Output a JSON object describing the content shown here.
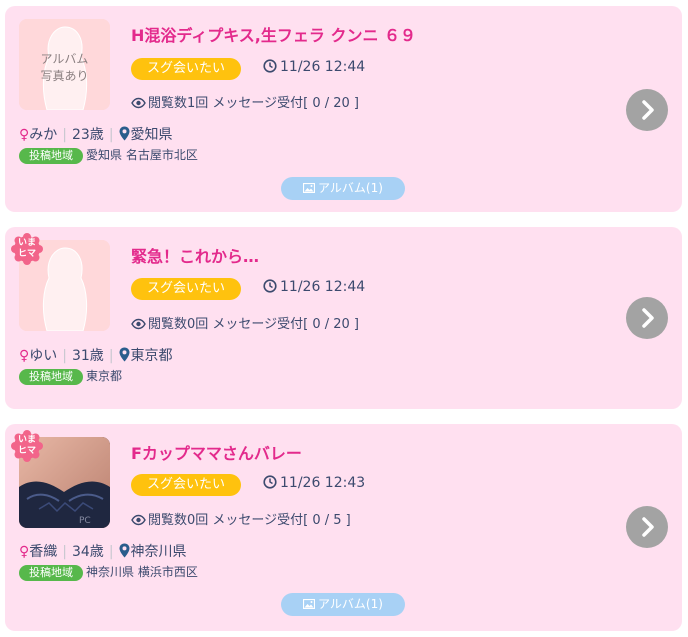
{
  "posts": [
    {
      "thumb_text": "アルバム\n写真あり",
      "badge": "",
      "title": "H混浴ディプキス,生フェラ クンニ ６９",
      "status_pill": "スグ会いたい",
      "time": "11/26 12:44",
      "views": "閲覧数1回 メッセージ受付[ 0 / 20 ]",
      "name": "みか",
      "age": "23歳",
      "prefecture": "愛知県",
      "region_label": "投稿地域",
      "region": "愛知県 名古屋市北区",
      "album": "アルバム(1)"
    },
    {
      "thumb_text": "",
      "badge": "いま\nヒマ",
      "title": "緊急！これから…",
      "status_pill": "スグ会いたい",
      "time": "11/26 12:44",
      "views": "閲覧数0回 メッセージ受付[ 0 / 20 ]",
      "name": "ゆい",
      "age": "31歳",
      "prefecture": "東京都",
      "region_label": "投稿地域",
      "region": "東京都",
      "album": ""
    },
    {
      "thumb_text": "",
      "badge": "いま\nヒマ",
      "title": "Fカップママさんバレー",
      "status_pill": "スグ会いたい",
      "time": "11/26 12:43",
      "views": "閲覧数0回 メッセージ受付[ 0 / 5 ]",
      "name": "香織",
      "age": "34歳",
      "prefecture": "神奈川県",
      "region_label": "投稿地域",
      "region": "神奈川県 横浜市西区",
      "album": "アルバム(1)"
    }
  ],
  "icons": {
    "female": "♀",
    "clock": "clock-icon",
    "eye": "eye-icon",
    "pin": "map-pin-icon",
    "arrow": "chevron-right-icon",
    "image": "image-icon"
  },
  "colors": {
    "card_bg": "#ffe0f0",
    "title": "#e32a8c",
    "pill": "#ffc20e",
    "region_label": "#57b84b",
    "arrow_button": "#a3a3a3",
    "album_button": "#a8d1f5",
    "text": "#3c4a6e"
  }
}
